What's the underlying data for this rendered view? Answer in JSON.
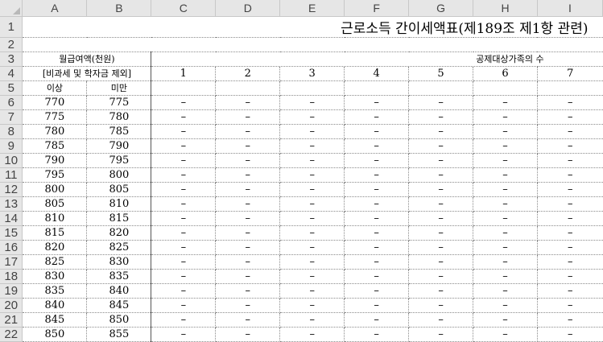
{
  "column_headers": [
    "A",
    "B",
    "C",
    "D",
    "E",
    "F",
    "G",
    "H",
    "I"
  ],
  "row_headers": [
    "1",
    "2",
    "3",
    "4",
    "5",
    "6",
    "7",
    "8",
    "9",
    "10",
    "11",
    "12",
    "13",
    "14",
    "15",
    "16",
    "17",
    "18",
    "19",
    "20",
    "21",
    "22"
  ],
  "title": "근로소득 간이세액표(제189조 제1항 관련)",
  "monthly_pay_label": "월급여액(천원)",
  "exclusion_label": "[비과세 및 학자금 제외]",
  "dependents_label": "공제대상가족의 수",
  "dependents_counts": [
    "1",
    "2",
    "3",
    "4",
    "5",
    "6",
    "7"
  ],
  "lower_label": "이상",
  "upper_label": "미만",
  "empty_value": "–",
  "table_rows": [
    {
      "from": "770",
      "to": "775"
    },
    {
      "from": "775",
      "to": "780"
    },
    {
      "from": "780",
      "to": "785"
    },
    {
      "from": "785",
      "to": "790"
    },
    {
      "from": "790",
      "to": "795"
    },
    {
      "from": "795",
      "to": "800"
    },
    {
      "from": "800",
      "to": "805"
    },
    {
      "from": "805",
      "to": "810"
    },
    {
      "from": "810",
      "to": "815"
    },
    {
      "from": "815",
      "to": "820"
    },
    {
      "from": "820",
      "to": "825"
    },
    {
      "from": "825",
      "to": "830"
    },
    {
      "from": "830",
      "to": "835"
    },
    {
      "from": "835",
      "to": "840"
    },
    {
      "from": "840",
      "to": "845"
    },
    {
      "from": "845",
      "to": "850"
    },
    {
      "from": "850",
      "to": "855"
    }
  ]
}
